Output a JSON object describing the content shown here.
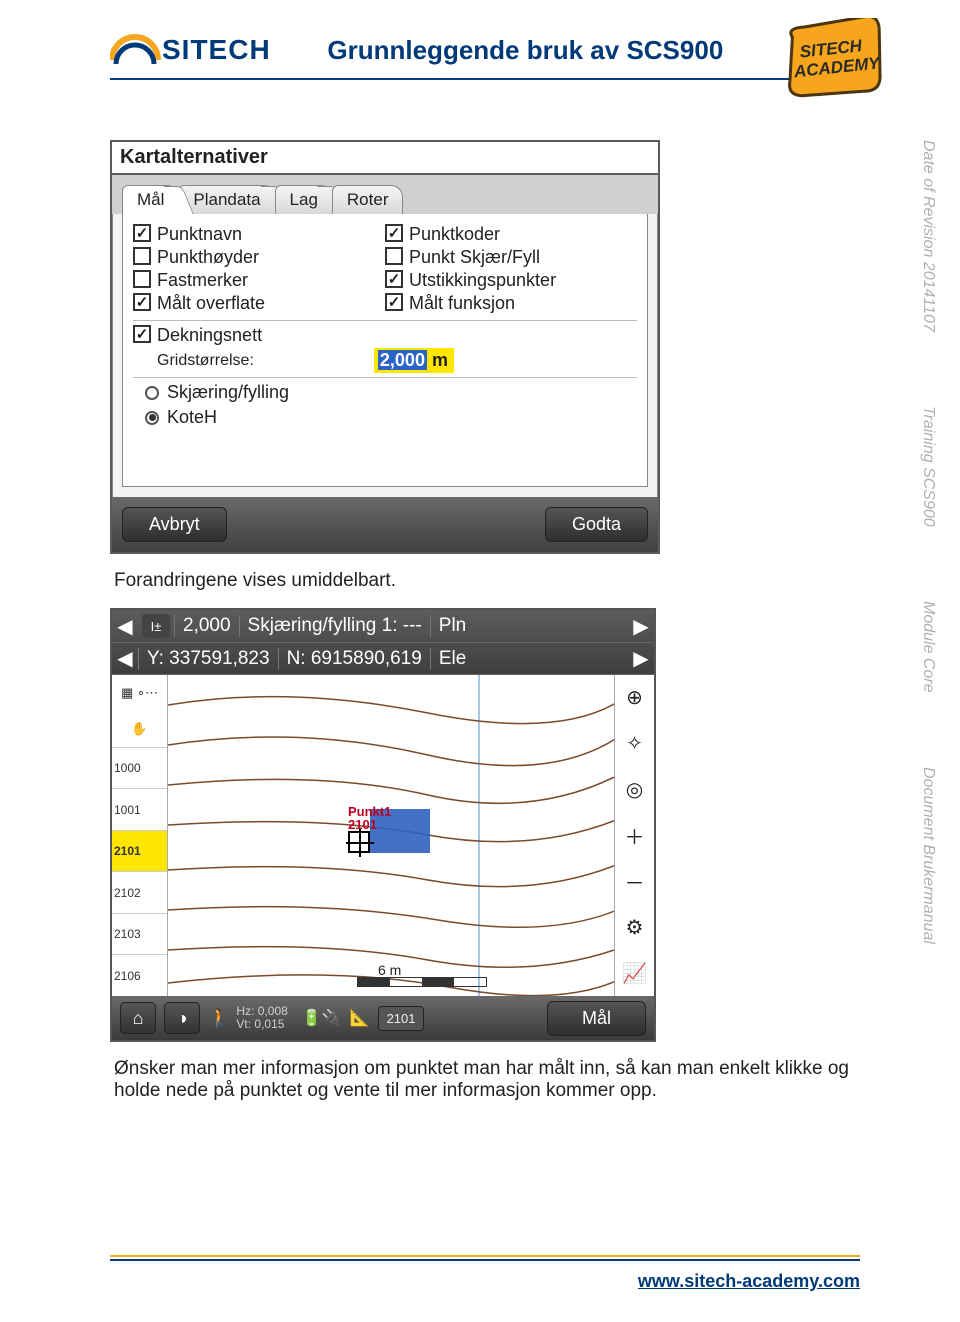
{
  "header": {
    "brand": "SITECH",
    "title": "Grunnleggende bruk av SCS900",
    "badge_line1": "SITECH",
    "badge_line2": "ACADEMY"
  },
  "side": {
    "revision": "Date of Revision 20141107",
    "training": "Training SCS900",
    "module": "Module Core",
    "document": "Document Brukermanual"
  },
  "dialog": {
    "title": "Kartalternativer",
    "tabs": [
      "Mål",
      "Plandata",
      "Lag",
      "Roter"
    ],
    "col1": [
      {
        "label": "Punktnavn",
        "checked": true
      },
      {
        "label": "Punkthøyder",
        "checked": false
      },
      {
        "label": "Fastmerker",
        "checked": false
      },
      {
        "label": "Målt overflate",
        "checked": true
      }
    ],
    "col2": [
      {
        "label": "Punktkoder",
        "checked": true
      },
      {
        "label": "Punkt Skjær/Fyll",
        "checked": false
      },
      {
        "label": "Utstikkingspunkter",
        "checked": true
      },
      {
        "label": "Målt funksjon",
        "checked": true
      }
    ],
    "dekningsnett": {
      "label": "Dekningsnett",
      "checked": true
    },
    "gridsize_label": "Gridstørrelse:",
    "gridsize_sel": "2,000",
    "gridsize_unit": " m",
    "radios": [
      {
        "label": "Skjæring/fylling",
        "on": false
      },
      {
        "label": "KoteH",
        "on": true
      }
    ],
    "cancel": "Avbryt",
    "accept": "Godta"
  },
  "text1": "Forandringene vises umiddelbart.",
  "map": {
    "row1": {
      "val": "2,000",
      "skj": "Skjæring/fylling 1: ---",
      "pln": "Pln"
    },
    "row2": {
      "y": "Y: 337591,823",
      "n": "N: 6915890,619",
      "el": "Ele"
    },
    "leftlabels": [
      "1000",
      "1001",
      "2101",
      "2102",
      "2103",
      "2106"
    ],
    "sel_label_index": 2,
    "punkt_name": "Punkt1",
    "punkt_code": "2101",
    "scale": "6 m",
    "hz": "Hz: 0,008",
    "vt": "Vt: 0,015",
    "chip": "2101",
    "maal": "Mål"
  },
  "text2": "Ønsker man mer informasjon om punktet man har målt inn, så kan man enkelt klikke og holde nede på punktet og vente til mer informasjon kommer opp.",
  "footer": {
    "link": "www.sitech-academy.com"
  }
}
